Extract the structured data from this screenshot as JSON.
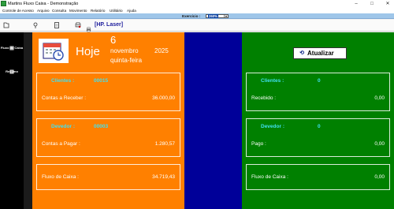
{
  "window": {
    "title": "Martins Fluxo Caixa - Demonstração",
    "minimize": "–",
    "maximize": "□",
    "close": "✕"
  },
  "menu": [
    "Controle de Acesso",
    "Arquivo",
    "Consulta",
    "Movimento",
    "Relatório",
    "Utilitário",
    "Ajuda"
  ],
  "zoom": {
    "label": "Exercício :",
    "value": "260%"
  },
  "toolbar": {
    "printer_label": "[HP. Laser]"
  },
  "sidebar": {
    "items": [
      {
        "label": "Fluxo de Caixa"
      },
      {
        "label": "Resumo"
      }
    ]
  },
  "date": {
    "hoje": "Hoje",
    "day": "6",
    "month": "novembro",
    "year": "2025",
    "weekday": "quinta-feira"
  },
  "left": {
    "clientes": {
      "label": "Clientes :",
      "count": "00015",
      "name": "Contas a Receber :",
      "value": "36.000,00"
    },
    "devedor": {
      "label": "Devedor :",
      "count": "00003",
      "name": "Contas a Pagar :",
      "value": "1.280,57"
    },
    "fluxo": {
      "name": "Fluxo de Caixa :",
      "value": "34.719,43"
    }
  },
  "right": {
    "button": "Atualizar",
    "clientes": {
      "label": "Clientes :",
      "count": "0",
      "name": "Recebido :",
      "value": "0,00"
    },
    "devedor": {
      "label": "Devedor :",
      "count": "0",
      "name": "Pago :",
      "value": "0,00"
    },
    "fluxo": {
      "name": "Fluxo de Caixa :",
      "value": "0,00"
    }
  },
  "colors": {
    "orange": "#ff8000",
    "blue": "#000099",
    "green": "#008000",
    "cyan_text": "#40e0f0"
  }
}
